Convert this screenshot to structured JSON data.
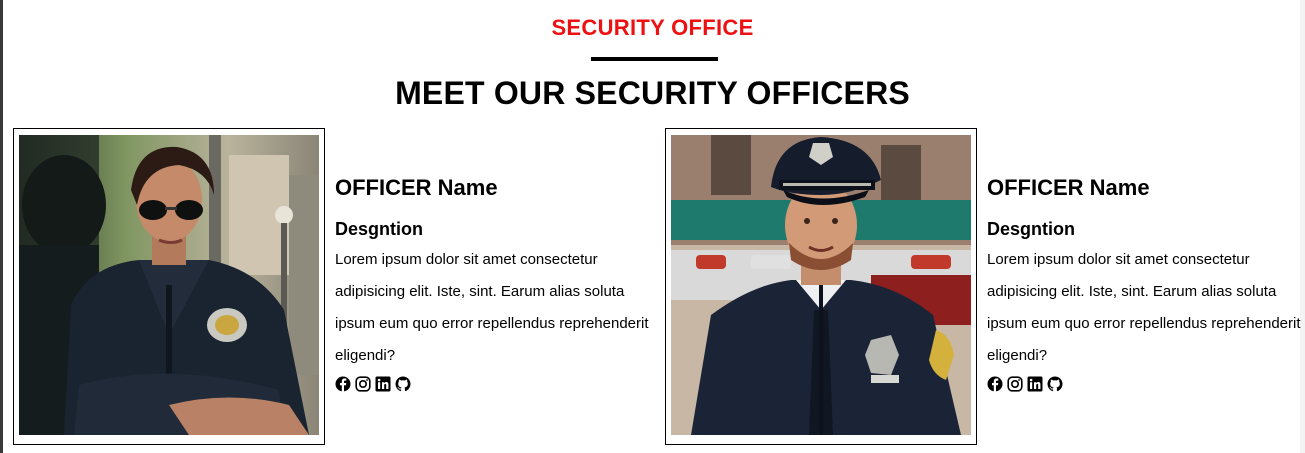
{
  "header": {
    "eyebrow": "SECURITY OFFICE",
    "title": "MEET OUR SECURITY OFFICERS"
  },
  "officers": [
    {
      "name": "OFFICER Name",
      "designation": "Desgntion",
      "description": "Lorem ipsum dolor sit amet consectetur adipisicing elit. Iste, sint. Earum alias soluta ipsum eum quo error repellendus reprehenderit eligendi?",
      "photo": "female-officer-photo"
    },
    {
      "name": "OFFICER Name",
      "designation": "Desgntion",
      "description": "Lorem ipsum dolor sit amet consectetur adipisicing elit. Iste, sint. Earum alias soluta ipsum eum quo error repellendus reprehenderit eligendi?",
      "photo": "male-officer-photo"
    }
  ],
  "social_icons": [
    "facebook-icon",
    "instagram-icon",
    "linkedin-icon",
    "github-icon"
  ],
  "colors": {
    "accent": "#ee1111",
    "text": "#000000",
    "background": "#ffffff"
  }
}
